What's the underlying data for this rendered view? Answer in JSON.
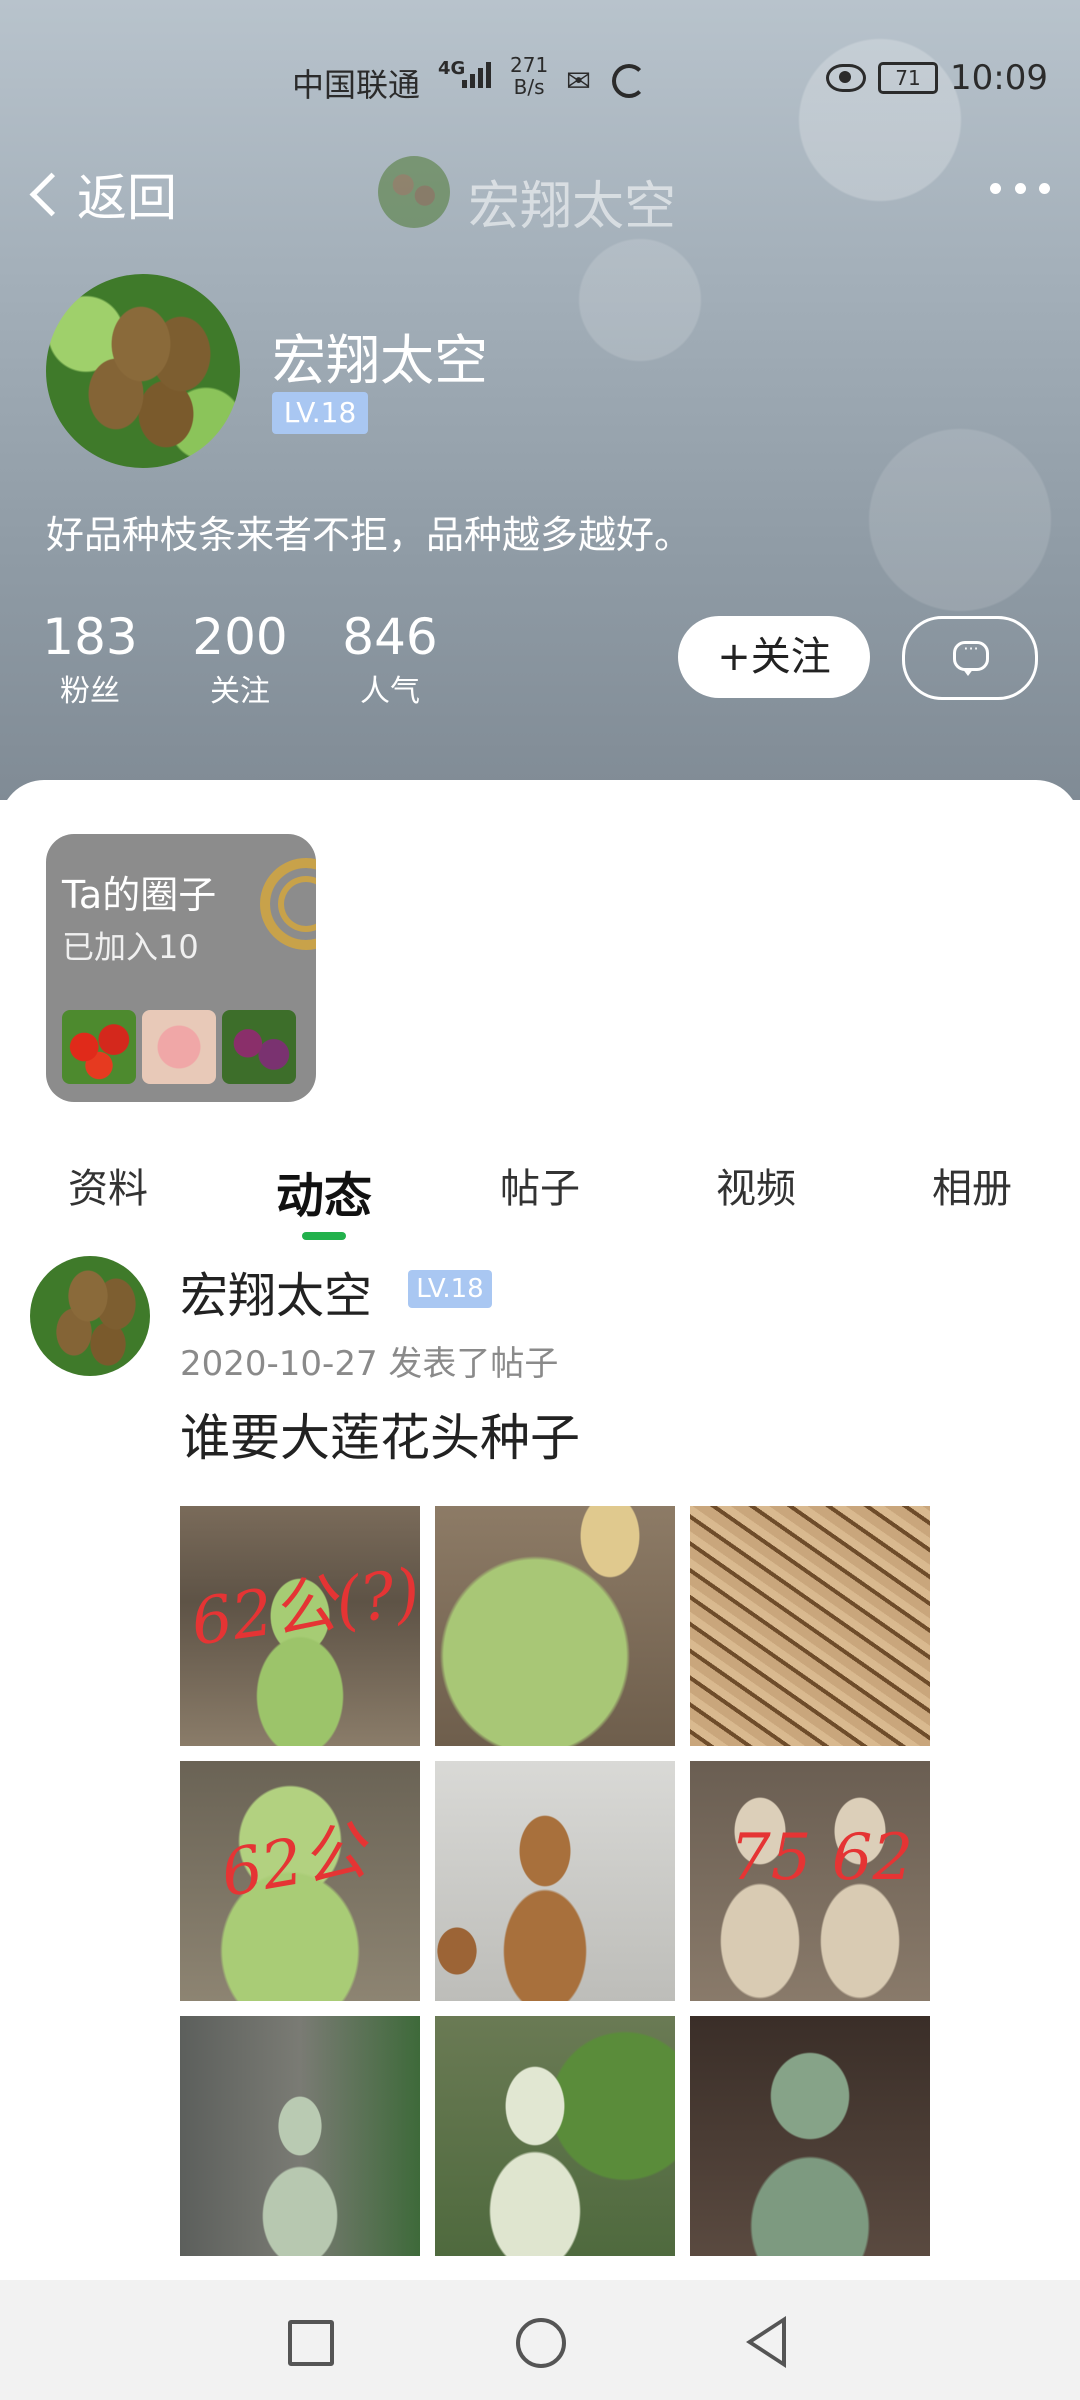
{
  "status_bar": {
    "carrier": "中国联通",
    "network": "4G",
    "speed_value": "271",
    "speed_unit": "B/s",
    "battery": "71",
    "time": "10:09",
    "icons": [
      "signal-icon",
      "wechat-icon",
      "sync-ring-icon",
      "eye-icon",
      "battery-icon"
    ]
  },
  "navbar": {
    "back_label": "返回",
    "title": "宏翔太空",
    "more_icon": "more-dots-icon"
  },
  "profile": {
    "name": "宏翔太空",
    "level": "LV.18",
    "bio": "好品种枝条来者不拒，品种越多越好。",
    "stats": [
      {
        "value": "183",
        "label": "粉丝"
      },
      {
        "value": "200",
        "label": "关注"
      },
      {
        "value": "846",
        "label": "人气"
      }
    ],
    "follow_label": "+关注",
    "message_icon": "chat-bubble-icon"
  },
  "circle": {
    "title": "Ta的圈子",
    "subtitle": "已加入10"
  },
  "tabs": [
    {
      "label": "资料",
      "active": false
    },
    {
      "label": "动态",
      "active": true
    },
    {
      "label": "帖子",
      "active": false
    },
    {
      "label": "视频",
      "active": false
    },
    {
      "label": "相册",
      "active": false
    }
  ],
  "post": {
    "author": "宏翔太空",
    "level": "LV.18",
    "meta": "2020-10-27  发表了帖子",
    "title": "谁要大莲花头种子",
    "image_annotations": [
      "62公(?)",
      "",
      "",
      "62公",
      "",
      "75 62",
      "",
      "",
      ""
    ]
  },
  "colors": {
    "accent_green": "#22b14c",
    "level_badge": "#a9c7f2"
  }
}
